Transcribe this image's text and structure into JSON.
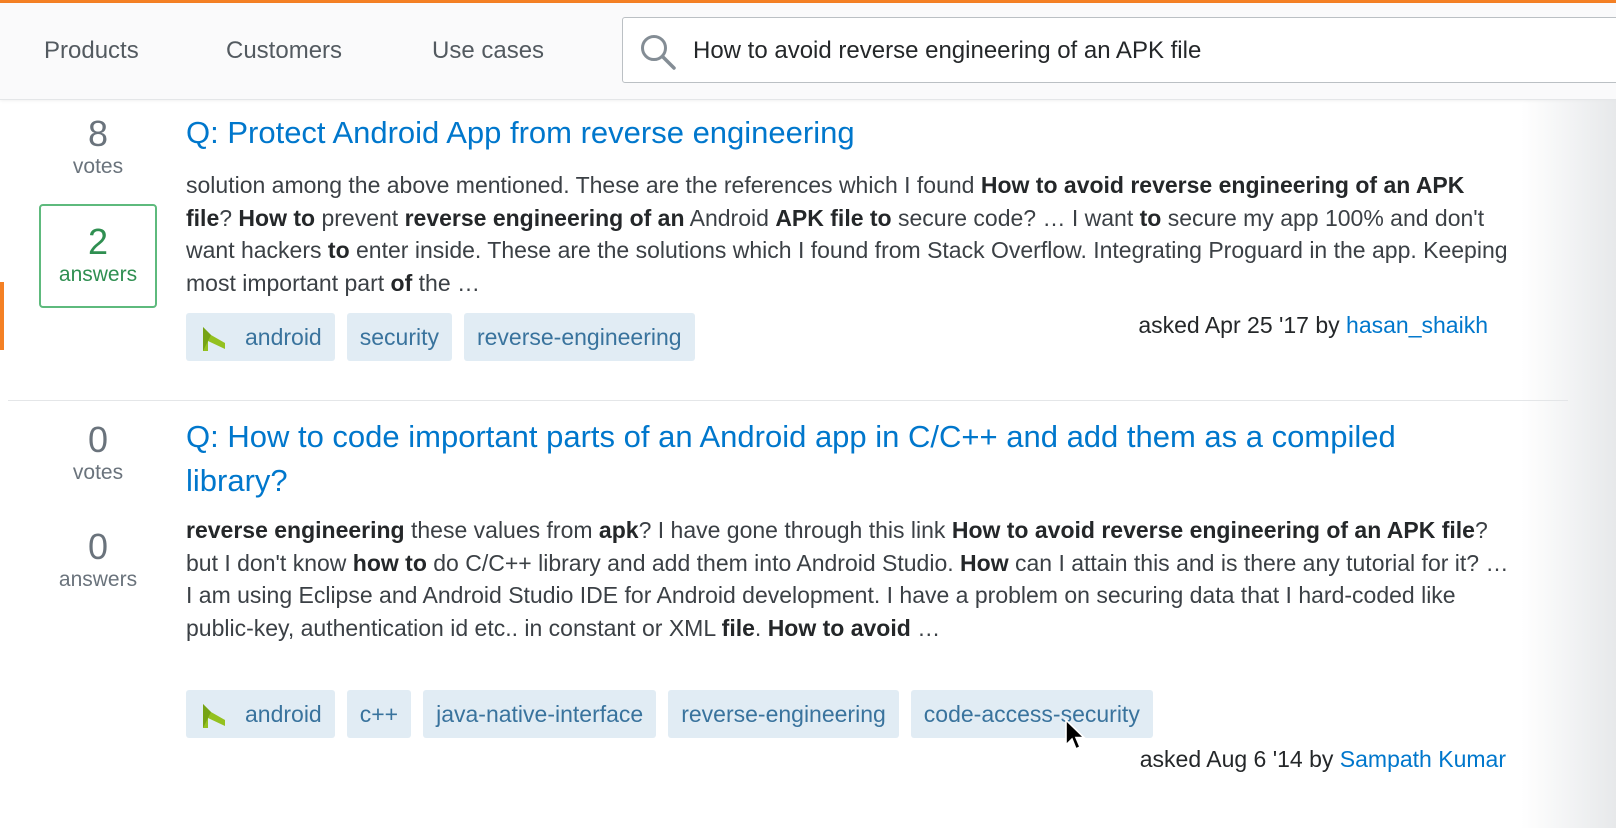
{
  "nav": {
    "products": "Products",
    "customers": "Customers",
    "use_cases": "Use cases"
  },
  "search": {
    "value": "How to avoid reverse engineering of an APK file",
    "icon": "search-icon"
  },
  "colors": {
    "accent": "#f48024",
    "link": "#0077cc",
    "tag_bg": "#e1ecf4",
    "tag_text": "#39739d",
    "accepted_green": "#5eba7d"
  },
  "results": [
    {
      "votes": "8",
      "votes_label": "votes",
      "answers": "2",
      "answers_label": "answers",
      "has_answer_box": true,
      "title": "Q: Protect Android App from reverse engineering",
      "excerpt": [
        {
          "t": "solution among the above mentioned. These are the references which I found ",
          "b": false
        },
        {
          "t": "How to avoid reverse engineering of an APK file",
          "b": true
        },
        {
          "t": "? ",
          "b": false
        },
        {
          "t": "How to",
          "b": true
        },
        {
          "t": " prevent ",
          "b": false
        },
        {
          "t": "reverse engineering of an",
          "b": true
        },
        {
          "t": " Android ",
          "b": false
        },
        {
          "t": "APK file to",
          "b": true
        },
        {
          "t": " secure code? … I want ",
          "b": false
        },
        {
          "t": "to",
          "b": true
        },
        {
          "t": " secure my app 100% and don't want hackers ",
          "b": false
        },
        {
          "t": "to",
          "b": true
        },
        {
          "t": " enter inside. These are the solutions which I found from Stack Overflow. Integrating Proguard in the app. Keeping most important part ",
          "b": false
        },
        {
          "t": "of",
          "b": true
        },
        {
          "t": " the …",
          "b": false
        }
      ],
      "tags": [
        "android",
        "security",
        "reverse-engineering"
      ],
      "asked": "asked Apr 25 '17 by",
      "user": "hasan_shaikh"
    },
    {
      "votes": "0",
      "votes_label": "votes",
      "answers": "0",
      "answers_label": "answers",
      "has_answer_box": false,
      "title": "Q: How to code important parts of an Android app in C/C++ and add them as a compiled library?",
      "excerpt": [
        {
          "t": "reverse engineering",
          "b": true
        },
        {
          "t": " these values from ",
          "b": false
        },
        {
          "t": "apk",
          "b": true
        },
        {
          "t": "? I have gone through this link ",
          "b": false
        },
        {
          "t": "How to avoid reverse engineering of an APK file",
          "b": true
        },
        {
          "t": "? but I don't know ",
          "b": false
        },
        {
          "t": "how to",
          "b": true
        },
        {
          "t": " do C/C++ library and add them into Android Studio. ",
          "b": false
        },
        {
          "t": "How",
          "b": true
        },
        {
          "t": " can I attain this and is there any tutorial for it? … I am using Eclipse and Android Studio IDE for Android development. I have a problem on securing data that I hard-coded like public-key, authentication id etc.. in constant or XML ",
          "b": false
        },
        {
          "t": "file",
          "b": true
        },
        {
          "t": ". ",
          "b": false
        },
        {
          "t": "How to avoid",
          "b": true
        },
        {
          "t": " …",
          "b": false
        }
      ],
      "tags": [
        "android",
        "c++",
        "java-native-interface",
        "reverse-engineering",
        "code-access-security"
      ],
      "asked": "asked Aug 6 '14 by",
      "user": "Sampath Kumar"
    }
  ]
}
